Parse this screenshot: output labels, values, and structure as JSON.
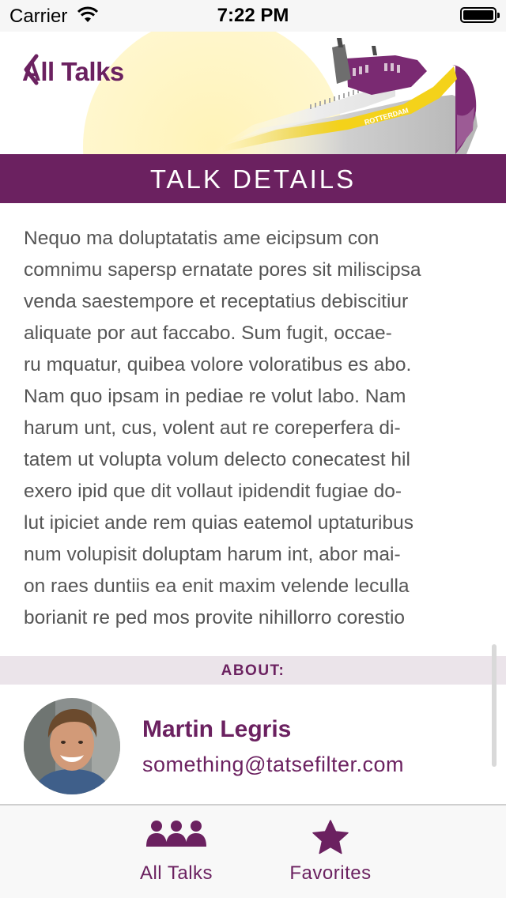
{
  "status_bar": {
    "carrier": "Carrier",
    "time": "7:22 PM",
    "battery_level": 1.0
  },
  "header": {
    "back_label": "All Talks",
    "ship_name": "ROTTERDAM"
  },
  "section_title": "TALK DETAILS",
  "description_lines": [
    "Nequo ma doluptatatis ame eicipsum con",
    "comnimu sapersp ernatate pores sit miliscipsa",
    "venda saestempore et receptatius debiscitiur",
    "aliquate por aut faccabo. Sum fugit, occae-",
    "ru mquatur, quibea volore voloratibus es abo.",
    "Nam quo ipsam in pediae re volut labo. Nam",
    "harum unt, cus, volent aut re coreperfera di-",
    "tatem ut volupta volum delecto conecatest hil",
    "exero ipid que dit vollaut ipidendit fugiae do-",
    "lut ipiciet ande rem quias eatemol uptaturibus",
    "num volupisit doluptam harum int, abor mai-",
    "on raes duntiis ea enit maxim velende leculla",
    "borianit re ped mos provite nihillorro corestio"
  ],
  "about": {
    "label": "ABOUT:",
    "speaker_name": "Martin Legris",
    "speaker_email": "something@tatsefilter.com"
  },
  "tab_bar": {
    "tabs": [
      {
        "label": "All Talks",
        "icon": "people-icon"
      },
      {
        "label": "Favorites",
        "icon": "star-icon"
      }
    ]
  },
  "colors": {
    "brand_purple": "#6b2160",
    "about_bar": "#ebe4ea",
    "text_gray": "#555555",
    "ship_yellow": "#f4d21a"
  }
}
